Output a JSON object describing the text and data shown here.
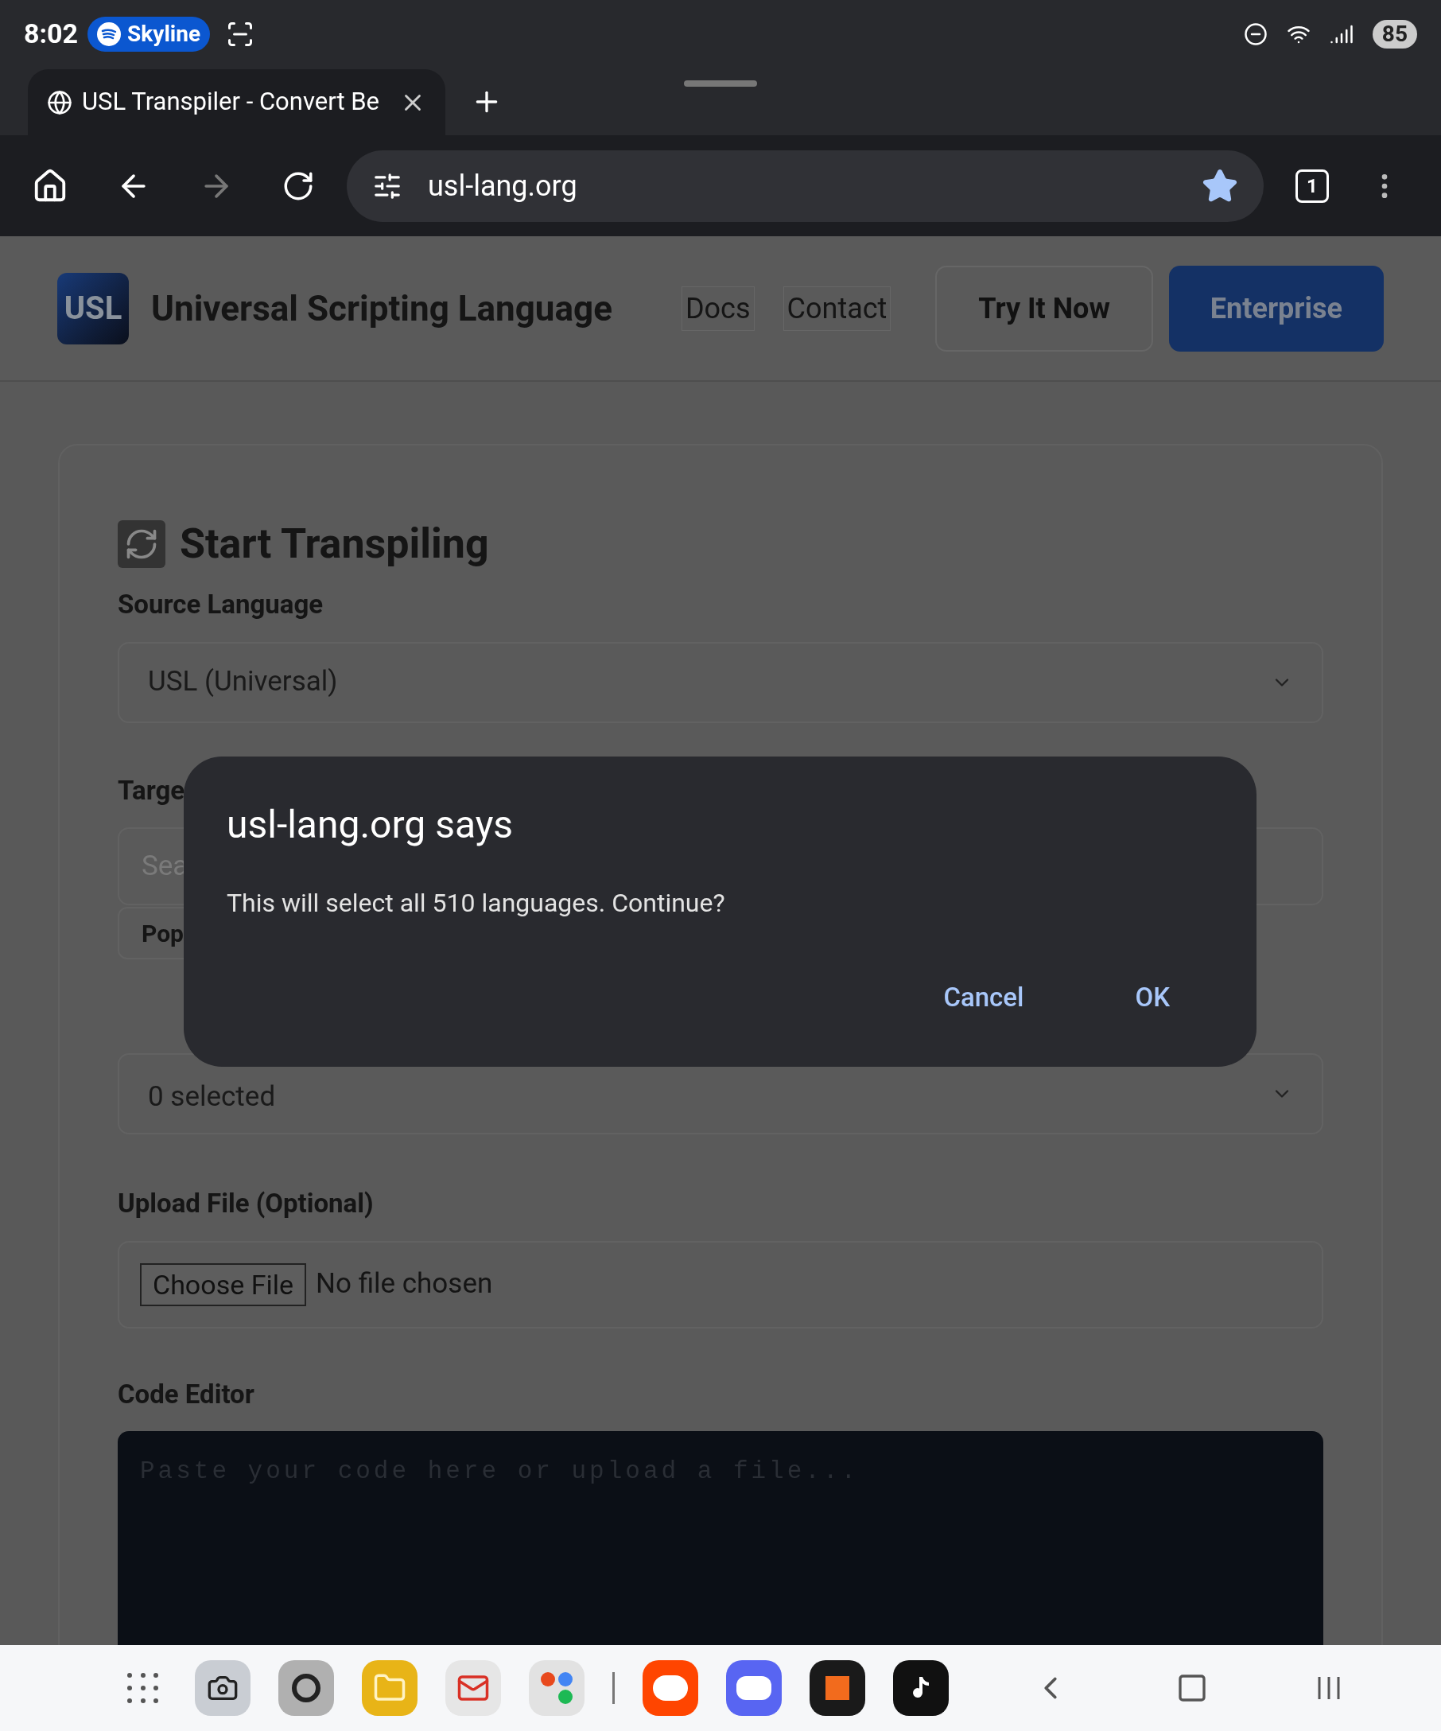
{
  "status_bar": {
    "time": "8:02",
    "media_chip": "Skyline",
    "battery": "85"
  },
  "browser": {
    "tab_title": "USL Transpiler - Convert Be",
    "url": "usl-lang.org",
    "tab_count": "1",
    "bookmarked": true
  },
  "site_header": {
    "logo": "USL",
    "title": "Universal Scripting Language",
    "nav": [
      "Docs",
      "Contact"
    ],
    "buttons": [
      {
        "label": "Try It Now",
        "kind": "outline"
      },
      {
        "label": "Enterprise",
        "kind": "primary"
      }
    ]
  },
  "form": {
    "heading": "Start Transpiling",
    "source_label": "Source Language",
    "source_value": "USL (Universal)",
    "target_label": "Targe",
    "search_placeholder": "Sea",
    "popular_button": "Pop",
    "target_select": "0 selected",
    "upload_label": "Upload File (Optional)",
    "file_button": "Choose File",
    "file_status": "No file chosen",
    "editor_label": "Code Editor",
    "editor_placeholder": "Paste your code here or upload a file..."
  },
  "dialog": {
    "title": "usl-lang.org says",
    "message": "This will select all 510 languages. Continue?",
    "buttons": [
      "Cancel",
      "OK"
    ]
  }
}
